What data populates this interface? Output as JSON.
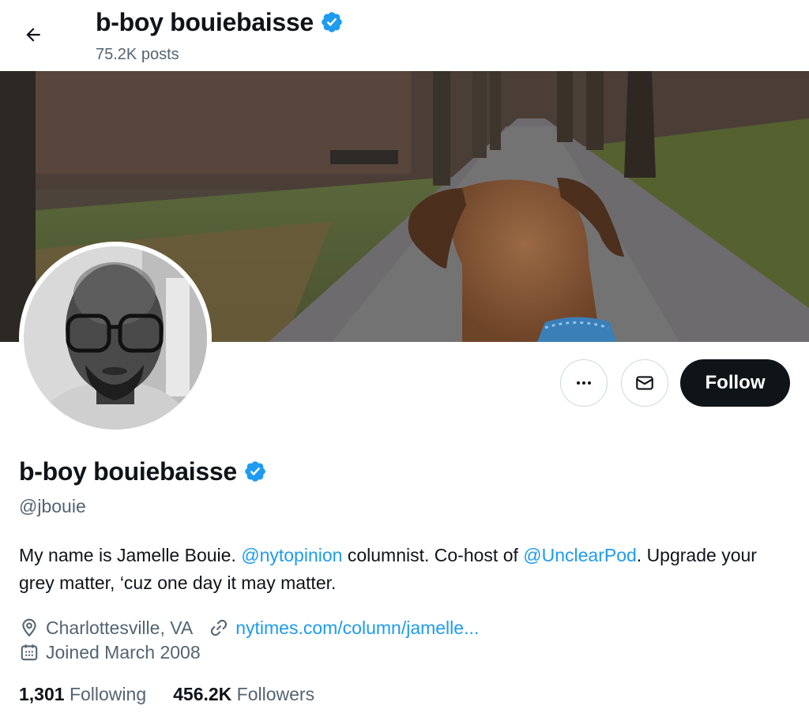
{
  "header": {
    "name": "b-boy bouiebaisse",
    "posts": "75.2K posts",
    "back_icon": "arrow-left-icon"
  },
  "profile": {
    "display_name": "b-boy bouiebaisse",
    "handle": "@jbouie",
    "verified_color": "#1d9bf0"
  },
  "actions": {
    "more_icon": "more-dots-icon",
    "message_icon": "envelope-icon",
    "follow_label": "Follow"
  },
  "bio": {
    "part1": "My name is Jamelle Bouie. ",
    "mention1": "@nytopinion",
    "part2": " columnist. Co-host of ",
    "mention2": "@UnclearPod",
    "part3": ". Upgrade your grey matter, ‘cuz one day it may matter."
  },
  "meta": {
    "location": "Charlottesville, VA",
    "url": "nytimes.com/column/jamelle...",
    "joined": "Joined March 2008"
  },
  "stats": {
    "following_count": "1,301",
    "following_label": "Following",
    "followers_count": "456.2K",
    "followers_label": "Followers"
  },
  "colors": {
    "accent": "#1d9bf0",
    "text": "#0f1419",
    "secondary": "#536471",
    "follow_bg": "#0f1419"
  }
}
